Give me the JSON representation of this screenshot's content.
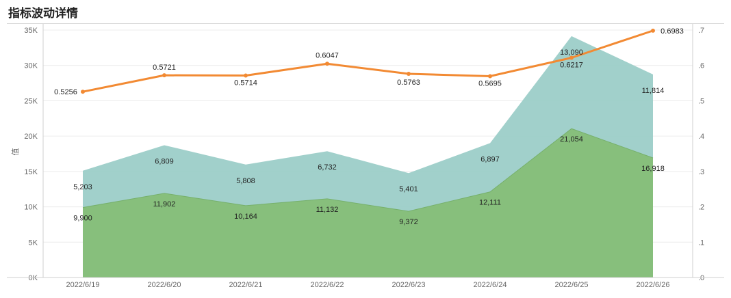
{
  "header": {
    "title": "指标波动详情"
  },
  "chart_data": {
    "type": "area",
    "categories": [
      "2022/6/19",
      "2022/6/20",
      "2022/6/21",
      "2022/6/22",
      "2022/6/23",
      "2022/6/24",
      "2022/6/25",
      "2022/6/26"
    ],
    "ylabel": "值",
    "y_left_ticks": [
      "0K",
      "5K",
      "10K",
      "15K",
      "20K",
      "25K",
      "30K",
      "35K"
    ],
    "y_right_ticks": [
      ".0",
      ".1",
      ".2",
      ".3",
      ".4",
      ".5",
      ".6",
      ".7"
    ],
    "ylim_left": [
      0,
      35000
    ],
    "ylim_right": [
      0,
      0.7
    ],
    "grid": true,
    "series": [
      {
        "type": "stacked-area",
        "axis": "left",
        "color": "#87bf7c",
        "values": [
          9900,
          11902,
          10164,
          11132,
          9372,
          12111,
          21054,
          16918
        ],
        "labels": [
          "9,900",
          "11,902",
          "10,164",
          "11,132",
          "9,372",
          "12,111",
          "21,054",
          "16,918"
        ]
      },
      {
        "type": "stacked-area",
        "axis": "left",
        "color": "#9ccdc8",
        "values": [
          5203,
          6809,
          5808,
          6732,
          5401,
          6897,
          13090,
          11814
        ],
        "labels": [
          "5,203",
          "6,809",
          "5,808",
          "6,732",
          "5,401",
          "6,897",
          "13,090",
          "11,814"
        ]
      },
      {
        "type": "line",
        "axis": "right",
        "color": "#f28a33",
        "values": [
          0.5256,
          0.5721,
          0.5714,
          0.6047,
          0.5763,
          0.5695,
          0.6217,
          0.6983
        ],
        "labels": [
          "0.5256",
          "0.5721",
          "0.5714",
          "0.6047",
          "0.5763",
          "0.5695",
          "0.6217",
          "0.6983"
        ]
      }
    ]
  }
}
